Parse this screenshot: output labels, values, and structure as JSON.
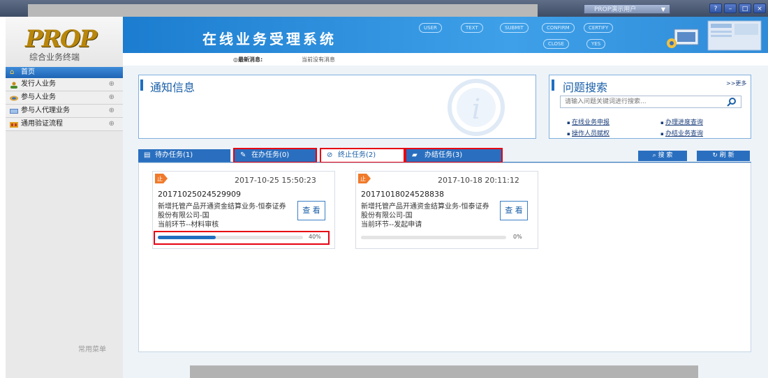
{
  "topbar": {
    "user_select": "PROP演示用户",
    "window_buttons": [
      "?",
      "–",
      "□",
      "×"
    ]
  },
  "sidebar": {
    "logo_text": "PROP",
    "subtitle": "综合业务终端",
    "home_label": "首页",
    "items": [
      {
        "label": "发行人业务",
        "icon": "person-icon"
      },
      {
        "label": "参与人业务",
        "icon": "handshake-icon"
      },
      {
        "label": "参与人代理业务",
        "icon": "monitor-icon"
      },
      {
        "label": "通用验证流程",
        "icon": "grid-icon"
      }
    ],
    "common_menu": "常用菜单"
  },
  "header": {
    "title": "在线业务受理系统",
    "flow_steps": [
      "USER",
      "TEXT",
      "SUBMIT",
      "CONFIRM",
      "CERTIFY"
    ],
    "flow_steps_row2": [
      "CLOSE",
      "YES"
    ],
    "latest_label": "◎最新消息:",
    "latest_value": "当前没有消息"
  },
  "notice": {
    "title": "通知信息"
  },
  "search": {
    "title": "问题搜索",
    "more": ">>更多",
    "placeholder": "请输入问题关键词进行搜索...",
    "links": [
      "在线业务申报",
      "办理进度查询",
      "操作人员赋权",
      "办结业务查询"
    ]
  },
  "tabs": [
    {
      "label": "待办任务(1)",
      "icon": "list-icon",
      "active": false,
      "highlighted": false
    },
    {
      "label": "在办任务(0)",
      "icon": "pencil-icon",
      "active": false,
      "highlighted": true
    },
    {
      "label": "终止任务(2)",
      "icon": "stop-icon",
      "active": true,
      "highlighted": true
    },
    {
      "label": "办结任务(3)",
      "icon": "folder-icon",
      "active": false,
      "highlighted": true
    }
  ],
  "actions": {
    "search_label": "搜 索",
    "refresh_label": "刷 新"
  },
  "tasks": [
    {
      "tag": "止",
      "time": "2017-10-25 15:50:23",
      "id": "20171025024529909",
      "desc": "新增托管产品开通资金结算业务-恒泰证券股份有限公司-国",
      "step": "当前环节--材料审核",
      "view_label": "查 看",
      "progress": 40,
      "progress_text": "40%",
      "progress_highlighted": true
    },
    {
      "tag": "止",
      "time": "2017-10-18 20:11:12",
      "id": "20171018024528838",
      "desc": "新增托管产品开通资金结算业务-恒泰证券股份有限公司-国",
      "step": "当前环节--发起申请",
      "view_label": "查 看",
      "progress": 0,
      "progress_text": "0%",
      "progress_highlighted": false
    }
  ],
  "colors": {
    "accent": "#1f6fc0",
    "highlight": "#e60012",
    "tag": "#f07a2a"
  }
}
